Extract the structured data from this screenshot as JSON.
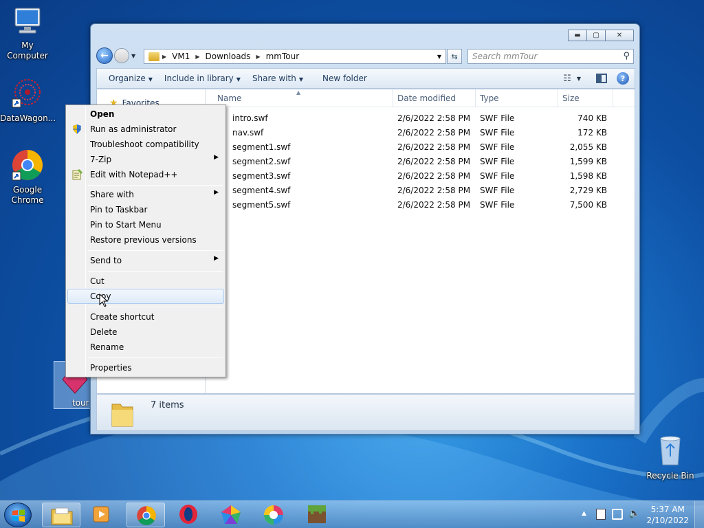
{
  "desktop": {
    "icons": [
      {
        "label": "My Computer"
      },
      {
        "label": "DataWagon..."
      },
      {
        "label": "Google Chrome"
      },
      {
        "label": "tour"
      },
      {
        "label": "Recycle Bin"
      }
    ]
  },
  "window": {
    "breadcrumb": [
      "VM1",
      "Downloads",
      "mmTour"
    ],
    "search_placeholder": "Search mmTour",
    "toolbar": {
      "organize": "Organize",
      "include_in_library": "Include in library",
      "share_with": "Share with",
      "new_folder": "New folder"
    },
    "nav_pane": {
      "favorites": "Favorites"
    },
    "columns": {
      "name": "Name",
      "date_modified": "Date modified",
      "type": "Type",
      "size": "Size"
    },
    "files": [
      {
        "name": "intro.swf",
        "date": "2/6/2022 2:58 PM",
        "type": "SWF File",
        "size": "740 KB"
      },
      {
        "name": "nav.swf",
        "date": "2/6/2022 2:58 PM",
        "type": "SWF File",
        "size": "172 KB"
      },
      {
        "name": "segment1.swf",
        "date": "2/6/2022 2:58 PM",
        "type": "SWF File",
        "size": "2,055 KB"
      },
      {
        "name": "segment2.swf",
        "date": "2/6/2022 2:58 PM",
        "type": "SWF File",
        "size": "1,599 KB"
      },
      {
        "name": "segment3.swf",
        "date": "2/6/2022 2:58 PM",
        "type": "SWF File",
        "size": "1,598 KB"
      },
      {
        "name": "segment4.swf",
        "date": "2/6/2022 2:58 PM",
        "type": "SWF File",
        "size": "2,729 KB"
      },
      {
        "name": "segment5.swf",
        "date": "2/6/2022 2:58 PM",
        "type": "SWF File",
        "size": "7,500 KB"
      }
    ],
    "status": {
      "item_count": "7 items"
    }
  },
  "context_menu": {
    "items": [
      {
        "label": "Open"
      },
      {
        "label": "Run as administrator"
      },
      {
        "label": "Troubleshoot compatibility"
      },
      {
        "label": "7-Zip"
      },
      {
        "label": "Edit with Notepad++"
      },
      {
        "label": "Share with"
      },
      {
        "label": "Pin to Taskbar"
      },
      {
        "label": "Pin to Start Menu"
      },
      {
        "label": "Restore previous versions"
      },
      {
        "label": "Send to"
      },
      {
        "label": "Cut"
      },
      {
        "label": "Copy"
      },
      {
        "label": "Create shortcut"
      },
      {
        "label": "Delete"
      },
      {
        "label": "Rename"
      },
      {
        "label": "Properties"
      }
    ],
    "highlighted": "Copy"
  },
  "taskbar": {
    "clock": {
      "time": "5:37 AM",
      "date": "2/10/2022"
    }
  }
}
